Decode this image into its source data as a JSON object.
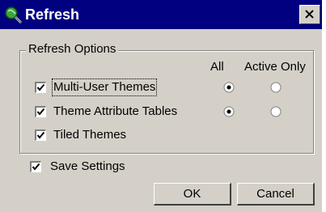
{
  "window": {
    "title": "Refresh",
    "title_bar_color": "#000080",
    "app_icon": "globe-magnifier-icon",
    "close_icon": "close-icon"
  },
  "refresh_options": {
    "group_label": "Refresh Options",
    "column_all": "All",
    "column_active_only": "Active Only",
    "rows": [
      {
        "label": "Multi-User Themes",
        "checked": true,
        "radio": "all"
      },
      {
        "label": "Theme Attribute Tables",
        "checked": true,
        "radio": "all"
      },
      {
        "label": "Tiled Themes",
        "checked": true,
        "radio": null
      }
    ]
  },
  "save_settings": {
    "label": "Save Settings",
    "checked": true
  },
  "buttons": {
    "ok": "OK",
    "cancel": "Cancel"
  }
}
